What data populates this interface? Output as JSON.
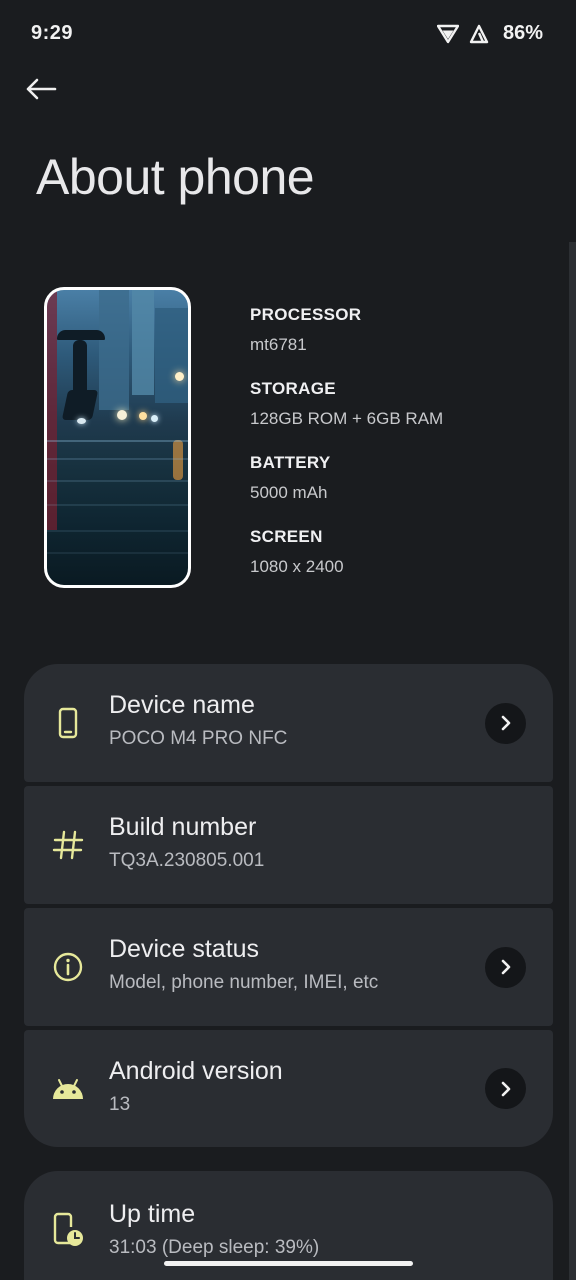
{
  "status_bar": {
    "time": "9:29",
    "battery": "86%",
    "wifi_icon": "wifi-icon",
    "signal_icon": "signal-icon"
  },
  "header": {
    "back_icon": "arrow-back-icon",
    "title": "About phone"
  },
  "hero": {
    "specs": [
      {
        "label": "PROCESSOR",
        "value": "mt6781"
      },
      {
        "label": "STORAGE",
        "value": "128GB ROM + 6GB RAM"
      },
      {
        "label": "BATTERY",
        "value": "5000 mAh"
      },
      {
        "label": "SCREEN",
        "value": "1080 x 2400"
      }
    ]
  },
  "settings": {
    "items": [
      {
        "title": "Device name",
        "subtitle": "POCO M4 PRO NFC",
        "icon": "phone-icon",
        "has_chevron": true
      },
      {
        "title": "Build number",
        "subtitle": "TQ3A.230805.001",
        "icon": "hash-icon",
        "has_chevron": false
      },
      {
        "title": "Device status",
        "subtitle": "Model, phone number, IMEI, etc",
        "icon": "info-icon",
        "has_chevron": true
      },
      {
        "title": "Android version",
        "subtitle": "13",
        "icon": "android-icon",
        "has_chevron": true
      }
    ],
    "uptime": {
      "title": "Up time",
      "subtitle": "31:03 (Deep sleep: 39%)",
      "icon": "phone-clock-icon"
    }
  },
  "colors": {
    "background": "#1a1c1f",
    "card": "#2a2d32",
    "accent_icon": "#e6e89a",
    "chevron_bg": "#141619"
  }
}
